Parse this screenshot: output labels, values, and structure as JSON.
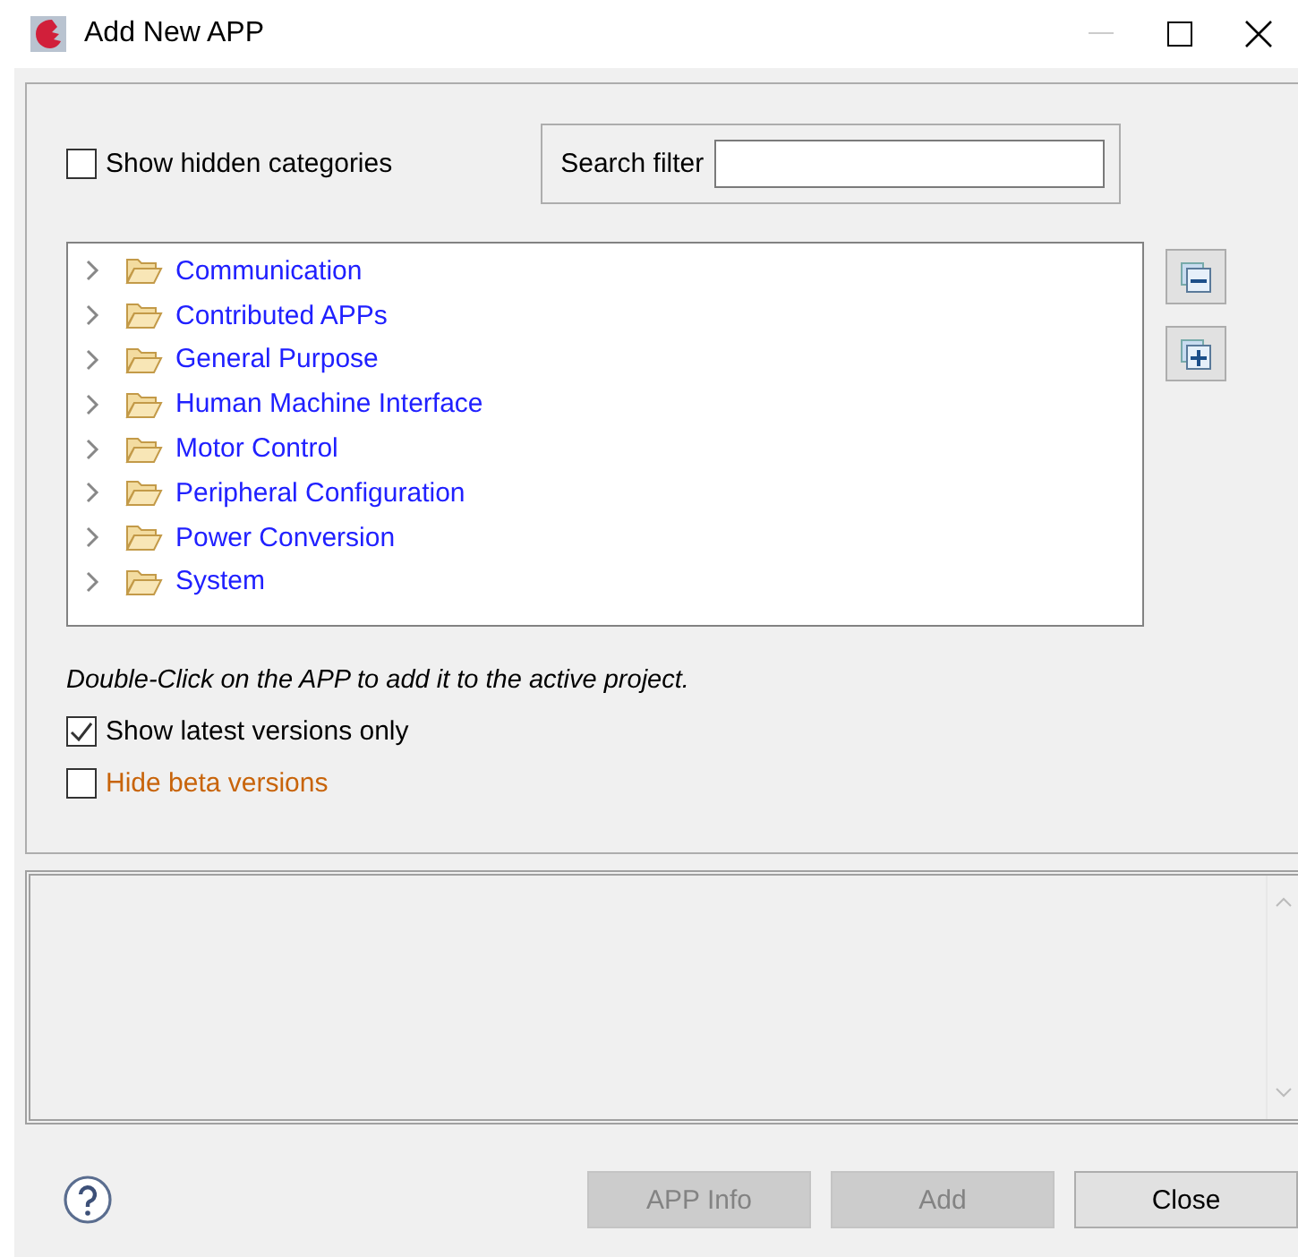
{
  "window": {
    "title": "Add New APP"
  },
  "show_hidden": {
    "label": "Show hidden categories",
    "checked": false
  },
  "search": {
    "label": "Search filter"
  },
  "tree": [
    {
      "label": "Communication",
      "expanded": false
    },
    {
      "label": "Contributed APPs",
      "expanded": false
    },
    {
      "label": "General Purpose",
      "expanded": false
    },
    {
      "label": "Human Machine Interface",
      "expanded": false
    },
    {
      "label": "Motor Control",
      "expanded": false
    },
    {
      "label": "Peripheral Configuration",
      "expanded": false
    },
    {
      "label": "Power Conversion",
      "expanded": false
    },
    {
      "label": "System",
      "expanded": false
    }
  ],
  "hint": "Double-Click on the APP to add it to the active project.",
  "options": [
    {
      "label": "Show latest versions only",
      "checked": true,
      "kind": "normal"
    },
    {
      "label": "Hide beta versions",
      "checked": false,
      "kind": "warning"
    }
  ],
  "buttons": [
    {
      "label": "APP Info",
      "disabled": true
    },
    {
      "label": "Add",
      "disabled": true
    },
    {
      "label": "Close",
      "disabled": false
    }
  ]
}
